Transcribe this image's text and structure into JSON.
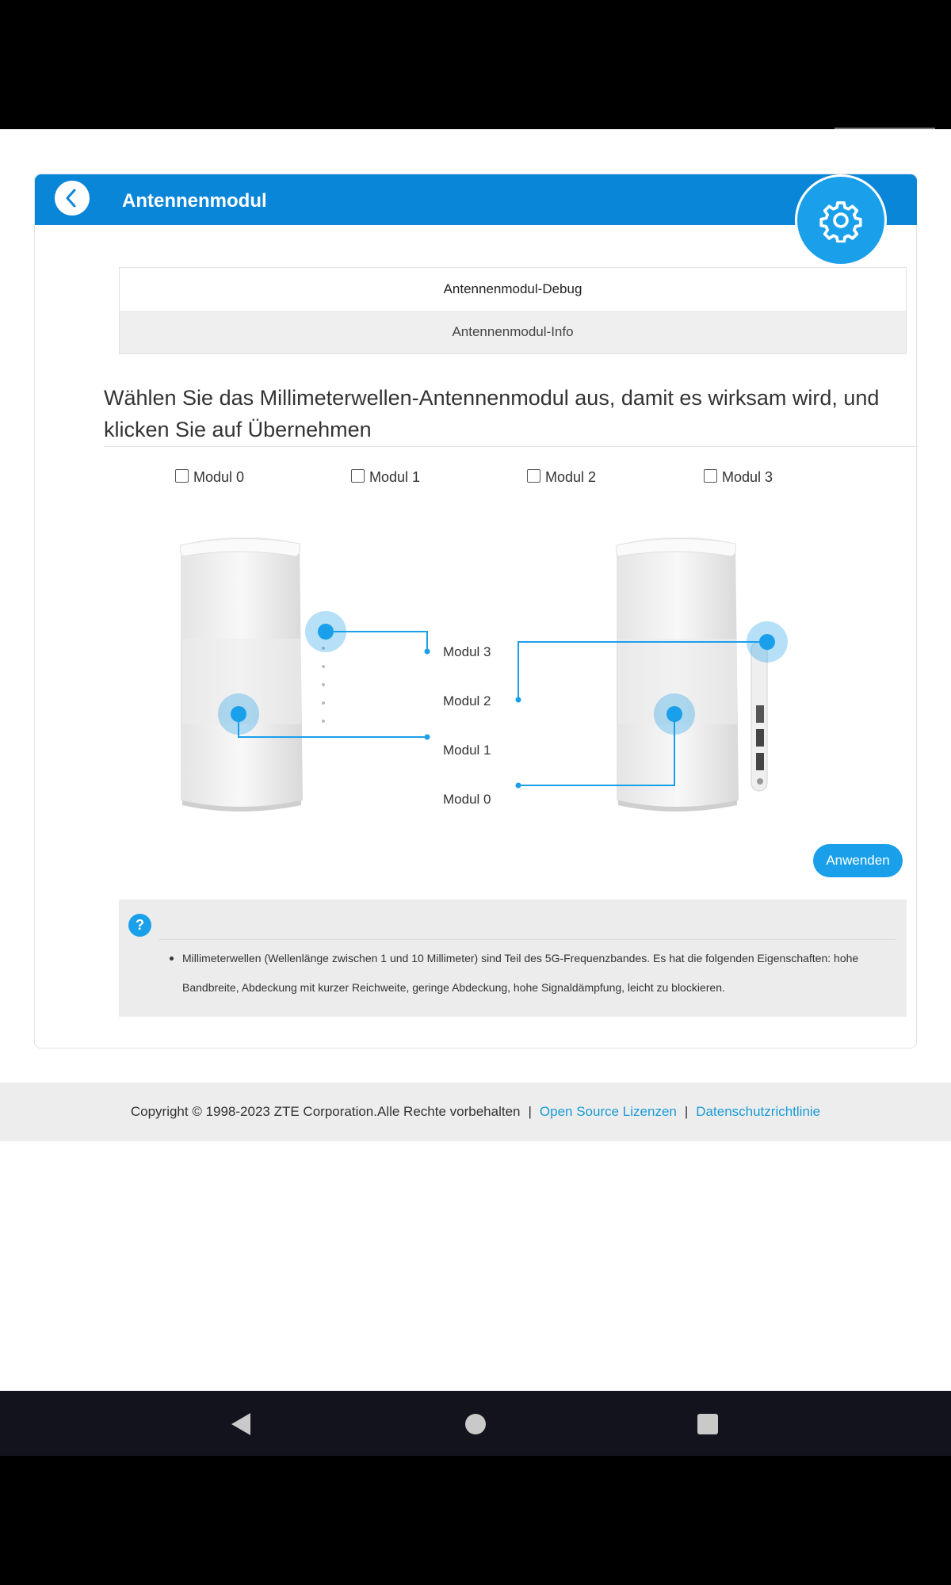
{
  "panel": {
    "title": "Antennenmodul",
    "back_icon": "chevron-left-icon",
    "settings_icon": "gear-icon",
    "accent_color": "#0a86d9",
    "badge_color": "#1aa0ea"
  },
  "tabs": [
    {
      "label": "Antennenmodul-Debug",
      "active": true
    },
    {
      "label": "Antennenmodul-Info",
      "active": false
    }
  ],
  "instruction": "Wählen Sie das Millimeterwellen-Antennenmodul aus, damit es wirksam wird, und klicken Sie auf Übernehmen",
  "modules": [
    {
      "label": "Modul 0",
      "checked": false
    },
    {
      "label": "Modul 1",
      "checked": false
    },
    {
      "label": "Modul 2",
      "checked": false
    },
    {
      "label": "Modul 3",
      "checked": false
    }
  ],
  "diagram": {
    "labels": [
      "Modul 3",
      "Modul 2",
      "Modul 1",
      "Modul 0"
    ]
  },
  "apply_label": "Anwenden",
  "help": {
    "icon": "question-icon",
    "text": "Millimeterwellen (Wellenlänge zwischen 1 und 10 Millimeter) sind Teil des 5G-Frequenzbandes. Es hat die folgenden Eigenschaften: hohe Bandbreite, Abdeckung mit kurzer Reichweite, geringe Abdeckung, hohe Signaldämpfung, leicht zu blockieren."
  },
  "footer": {
    "copyright": "Copyright © 1998-2023 ZTE Corporation.Alle Rechte vorbehalten",
    "separator": "|",
    "open_source": "Open Source Lizenzen",
    "privacy": "Datenschutzrichtlinie"
  },
  "navbar": {
    "back_icon": "triangle-back-icon",
    "home_icon": "circle-home-icon",
    "recents_icon": "square-recents-icon"
  }
}
